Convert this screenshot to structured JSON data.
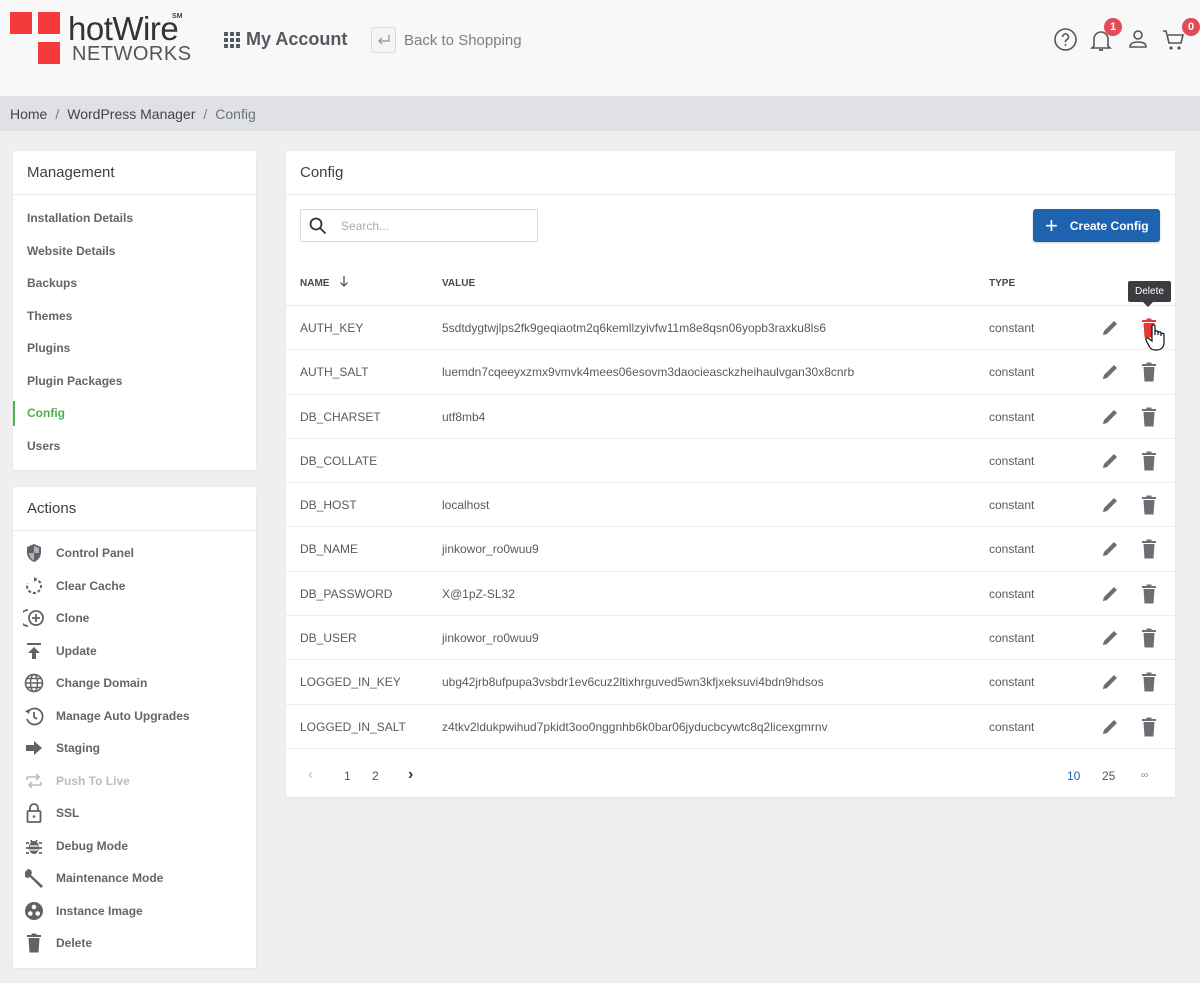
{
  "brand": {
    "name": "hotWire",
    "mark": "SM",
    "sub": "NETWORKS",
    "accent": "#f43a3a"
  },
  "header": {
    "my_account": "My Account",
    "back_to_shopping": "Back to Shopping",
    "notifications_count": "1",
    "cart_count": "0",
    "icons": [
      "help-circle-icon",
      "bell-icon",
      "user-icon",
      "cart-icon"
    ]
  },
  "breadcrumb": [
    "Home",
    "WordPress Manager",
    "Config"
  ],
  "management": {
    "title": "Management",
    "items": [
      {
        "label": "Installation Details"
      },
      {
        "label": "Website Details"
      },
      {
        "label": "Backups"
      },
      {
        "label": "Themes"
      },
      {
        "label": "Plugins"
      },
      {
        "label": "Plugin Packages"
      },
      {
        "label": "Config",
        "active": true
      },
      {
        "label": "Users"
      }
    ]
  },
  "actions": {
    "title": "Actions",
    "items": [
      {
        "label": "Control Panel",
        "icon": "shield-icon"
      },
      {
        "label": "Clear Cache",
        "icon": "refresh-icon"
      },
      {
        "label": "Clone",
        "icon": "clone-plus-icon"
      },
      {
        "label": "Update",
        "icon": "upload-arrow-icon"
      },
      {
        "label": "Change Domain",
        "icon": "globe-icon"
      },
      {
        "label": "Manage Auto Upgrades",
        "icon": "history-icon"
      },
      {
        "label": "Staging",
        "icon": "arrow-right-icon"
      },
      {
        "label": "Push To Live",
        "icon": "repeat-icon",
        "disabled": true
      },
      {
        "label": "SSL",
        "icon": "lock-icon"
      },
      {
        "label": "Debug Mode",
        "icon": "bug-icon"
      },
      {
        "label": "Maintenance Mode",
        "icon": "wrench-icon"
      },
      {
        "label": "Instance Image",
        "icon": "image-circle-icon"
      },
      {
        "label": "Delete",
        "icon": "trash-icon"
      }
    ]
  },
  "config": {
    "title": "Config",
    "search_placeholder": "Search...",
    "create_label": "Create Config",
    "columns": {
      "name": "NAME",
      "value": "VALUE",
      "type": "TYPE"
    },
    "sort": "name-descending",
    "tooltip": "Delete",
    "rows": [
      {
        "name": "AUTH_KEY",
        "value": "5sdtdygtwjlps2fk9geqiaotm2q6kemllzyivfw11m8e8qsn06yopb3raxku8ls6",
        "type": "constant"
      },
      {
        "name": "AUTH_SALT",
        "value": "luemdn7cqeeyxzmx9vmvk4mees06esovm3daocieasckzheihaulvgan30x8cnrb",
        "type": "constant"
      },
      {
        "name": "DB_CHARSET",
        "value": "utf8mb4",
        "type": "constant"
      },
      {
        "name": "DB_COLLATE",
        "value": "",
        "type": "constant"
      },
      {
        "name": "DB_HOST",
        "value": "localhost",
        "type": "constant"
      },
      {
        "name": "DB_NAME",
        "value": "jinkowor_ro0wuu9",
        "type": "constant"
      },
      {
        "name": "DB_PASSWORD",
        "value": "X@1pZ-SL32",
        "type": "constant"
      },
      {
        "name": "DB_USER",
        "value": "jinkowor_ro0wuu9",
        "type": "constant"
      },
      {
        "name": "LOGGED_IN_KEY",
        "value": "ubg42jrb8ufpupa3vsbdr1ev6cuz2ltixhrguved5wn3kfjxeksuvi4bdn9hdsos",
        "type": "constant"
      },
      {
        "name": "LOGGED_IN_SALT",
        "value": "z4tkv2ldukpwihud7pkidt3oo0nggnhb6k0bar06jyducbcywtc8q2licexgmrnv",
        "type": "constant"
      }
    ],
    "pagination": {
      "prev": "‹",
      "pages": [
        "1",
        "2"
      ],
      "current_page": "1",
      "next": "›",
      "page_sizes": [
        "10",
        "25",
        "∞"
      ],
      "current_page_size": "10"
    }
  },
  "colors": {
    "primary": "#1e63b0",
    "active": "#4caf50",
    "danger": "#e53935",
    "badge": "#e24b57"
  }
}
